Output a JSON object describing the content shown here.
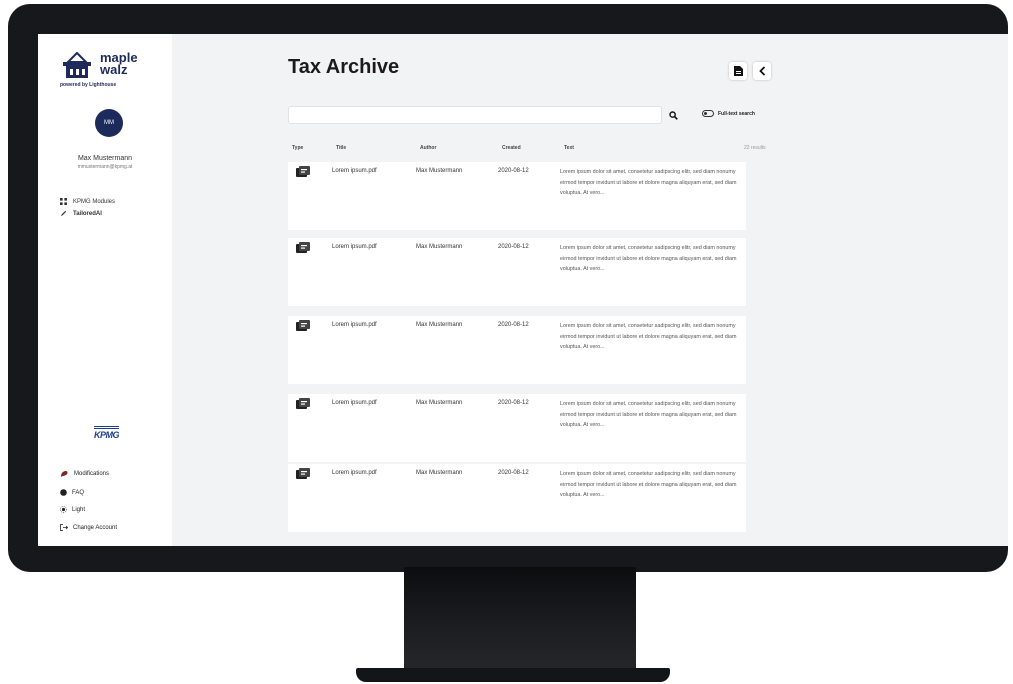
{
  "brand": {
    "logo_text": "maple walz",
    "logo_sub": "powered by Lighthouse"
  },
  "user": {
    "initials": "MM",
    "name": "Max Mustermann",
    "email": "mmustermann@kpmg.at"
  },
  "sidebar": {
    "items": [
      {
        "label": "KPMG Modules",
        "icon": "grid-icon"
      },
      {
        "label": "TailoredAI",
        "icon": "pen-icon"
      }
    ],
    "partner_logo": "KPMG",
    "bottom_items": [
      {
        "label": "Modifications",
        "icon": "flag-icon"
      },
      {
        "label": "FAQ",
        "icon": "help-icon"
      },
      {
        "label": "Light",
        "icon": "sun-icon"
      },
      {
        "label": "Change Account",
        "icon": "logout-icon"
      }
    ]
  },
  "main": {
    "title": "Tax Archive",
    "search": {
      "value": "",
      "placeholder": ""
    },
    "fulltext_label": "Full-text search",
    "columns": [
      "Type",
      "Title",
      "Author",
      "Created",
      "Text"
    ],
    "results_label": "22 results",
    "rows": [
      {
        "title": "Lorem ipsum.pdf",
        "author": "Max Mustermann",
        "created": "2020-08-12",
        "text": "Lorem ipsum dolor sit amet, consetetur sadipscing elitr, sed diam nonumy eirmod tempor invidunt ut labore et dolore magna aliquyam erat, sed diam voluptua. At vero..."
      },
      {
        "title": "Lorem ipsum.pdf",
        "author": "Max Mustermann",
        "created": "2020-08-12",
        "text": "Lorem ipsum dolor sit amet, consetetur sadipscing elitr, sed diam nonumy eirmod tempor invidunt ut labore et dolore magna aliquyam erat, sed diam voluptua. At vero..."
      },
      {
        "title": "Lorem ipsum.pdf",
        "author": "Max Mustermann",
        "created": "2020-08-12",
        "text": "Lorem ipsum dolor sit amet, consetetur sadipscing elitr, sed diam nonumy eirmod tempor invidunt ut labore et dolore magna aliquyam erat, sed diam voluptua. At vero..."
      },
      {
        "title": "Lorem ipsum.pdf",
        "author": "Max Mustermann",
        "created": "2020-08-12",
        "text": "Lorem ipsum dolor sit amet, consetetur sadipscing elitr, sed diam nonumy eirmod tempor invidunt ut labore et dolore magna aliquyam erat, sed diam voluptua. At vero..."
      },
      {
        "title": "Lorem ipsum.pdf",
        "author": "Max Mustermann",
        "created": "2020-08-12",
        "text": "Lorem ipsum dolor sit amet, consetetur sadipscing elitr, sed diam nonumy eirmod tempor invidunt ut labore et dolore magna aliquyam erat, sed diam voluptua. At vero..."
      }
    ]
  },
  "colors": {
    "brand_navy": "#1e2a5a",
    "kpmg_blue": "#1d3d8f",
    "bezel": "#17181b"
  }
}
